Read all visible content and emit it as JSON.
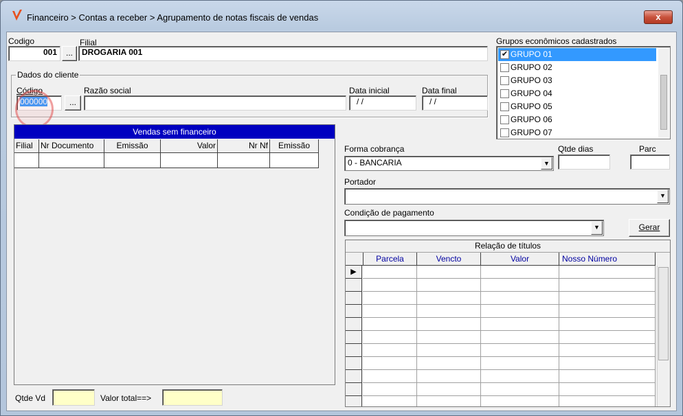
{
  "window": {
    "title": "Financeiro > Contas a receber > Agrupamento de notas fiscais de vendas",
    "close_label": "x"
  },
  "header": {
    "codigo_label": "Codigo",
    "codigo_value": "001",
    "lookup_label": "...",
    "filial_label": "Filial",
    "filial_value": "DROGARIA 001"
  },
  "cliente": {
    "group_title": "Dados do cliente",
    "codigo_label": "Código",
    "codigo_value": "000000",
    "lookup_label": "...",
    "razao_label": "Razão social",
    "razao_value": "",
    "data_inicial_label": "Data inicial",
    "data_inicial_value": "/ /",
    "data_final_label": "Data final",
    "data_final_value": "/ /"
  },
  "grupos": {
    "label": "Grupos econômicos cadastrados",
    "items": [
      {
        "label": "GRUPO 01",
        "checked": true,
        "selected": true
      },
      {
        "label": "GRUPO 02",
        "checked": false
      },
      {
        "label": "GRUPO 03",
        "checked": false
      },
      {
        "label": "GRUPO 04",
        "checked": false
      },
      {
        "label": "GRUPO 05",
        "checked": false
      },
      {
        "label": "GRUPO 06",
        "checked": false
      },
      {
        "label": "GRUPO 07",
        "checked": false
      }
    ],
    "check_glyph": "✔"
  },
  "vendas": {
    "caption": "Vendas sem financeiro",
    "columns": [
      "Filial",
      "Nr Documento",
      "Emissão",
      "Valor",
      "Nr Nf",
      "Emissão"
    ]
  },
  "cobranca": {
    "forma_label": "Forma cobrança",
    "forma_value": "0 - BANCARIA",
    "qtde_dias_label": "Qtde dias",
    "parc_label": "Parc",
    "portador_label": "Portador",
    "portador_value": "",
    "condicao_label": "Condição de pagamento",
    "condicao_value": "",
    "gerar_label": "Gerar",
    "dropdown_glyph": "▼"
  },
  "titulos": {
    "caption": "Relação de títulos",
    "columns": [
      "Parcela",
      "Vencto",
      "Valor",
      "Nosso Número"
    ],
    "indicator_glyph": "▶"
  },
  "footer": {
    "qtde_vd_label": "Qtde Vd",
    "valor_total_label": "Valor total==>"
  }
}
